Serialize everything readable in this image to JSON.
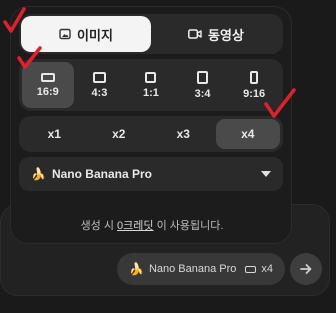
{
  "tabs": [
    {
      "label": "이미지",
      "icon": "image-icon",
      "active": true
    },
    {
      "label": "동영상",
      "icon": "video-icon",
      "active": false
    }
  ],
  "aspect_ratios": [
    {
      "label": "16:9",
      "icon": "ratio-16-9-icon",
      "active": true
    },
    {
      "label": "4:3",
      "icon": "ratio-4-3-icon",
      "active": false
    },
    {
      "label": "1:1",
      "icon": "ratio-1-1-icon",
      "active": false
    },
    {
      "label": "3:4",
      "icon": "ratio-3-4-icon",
      "active": false
    },
    {
      "label": "9:16",
      "icon": "ratio-9-16-icon",
      "active": false
    }
  ],
  "counts": [
    {
      "label": "x1",
      "active": false
    },
    {
      "label": "x2",
      "active": false
    },
    {
      "label": "x3",
      "active": false
    },
    {
      "label": "x4",
      "active": true
    }
  ],
  "model": {
    "label": "Nano Banana Pro",
    "icon": "banana-icon"
  },
  "credit_note": {
    "before": "생성 시 ",
    "link": "0크레딧",
    "after": " 이 사용됩니다."
  },
  "chip": {
    "model": "Nano Banana Pro",
    "count": "x4"
  },
  "colors": {
    "annotation": "#e0202a",
    "active_tab": "#f4f4f4",
    "active_option": "#4a4a4a"
  }
}
